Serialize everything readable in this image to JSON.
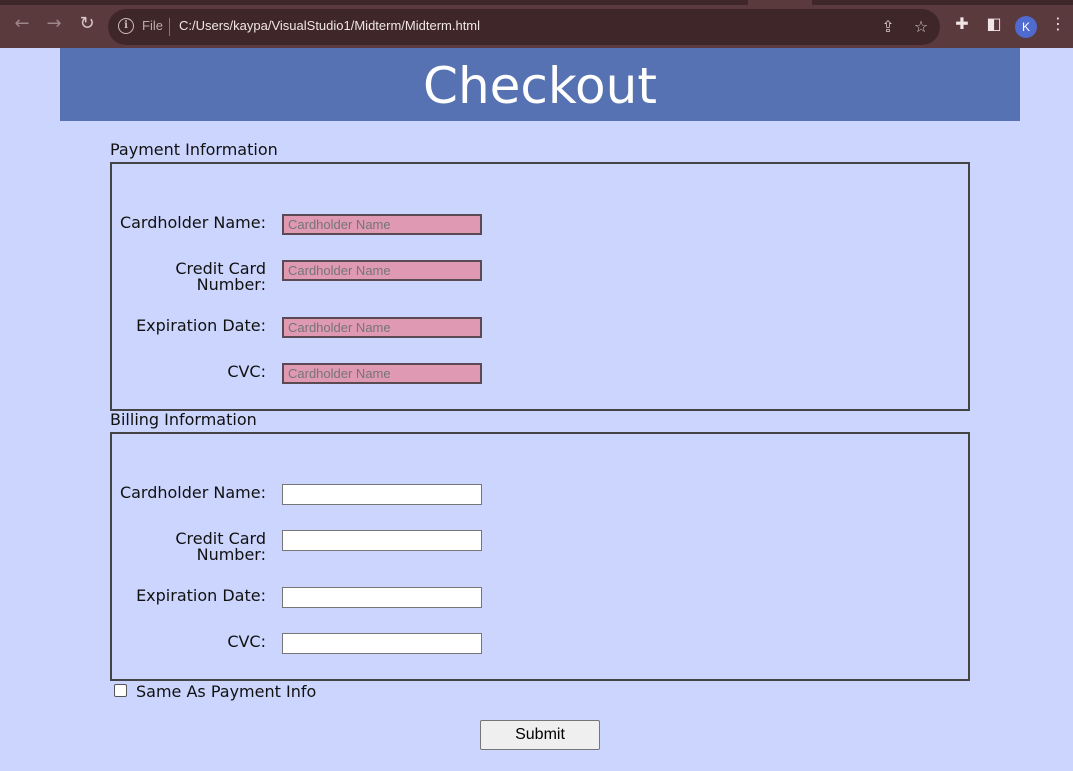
{
  "browser": {
    "file_label": "File",
    "url": "C:/Users/kaypa/VisualStudio1/Midterm/Midterm.html",
    "avatar_initial": "K",
    "icons": [
      "back-icon",
      "forward-icon",
      "reload-icon",
      "info-icon",
      "share-icon",
      "star-icon",
      "extensions-icon",
      "sidepanel-icon",
      "menu-icon"
    ]
  },
  "page": {
    "title": "Checkout",
    "payment": {
      "legend": "Payment Information",
      "fields": [
        {
          "label": "Cardholder Name:",
          "placeholder": "Cardholder Name"
        },
        {
          "label_line1": "Credit Card",
          "label_line2": "Number:",
          "placeholder": "Cardholder Name"
        },
        {
          "label": "Expiration Date:",
          "placeholder": "Cardholder Name"
        },
        {
          "label": "CVC:",
          "placeholder": "Cardholder Name"
        }
      ]
    },
    "billing": {
      "legend": "Billing Information",
      "fields": [
        {
          "label": "Cardholder Name:",
          "value": ""
        },
        {
          "label_line1": "Credit Card",
          "label_line2": "Number:",
          "value": ""
        },
        {
          "label": "Expiration Date:",
          "value": ""
        },
        {
          "label": "CVC:",
          "value": ""
        }
      ]
    },
    "same_as_payment": {
      "label": "Same As Payment Info",
      "checked": false
    },
    "submit_label": "Submit"
  },
  "colors": {
    "page_background": "#cbd5fd",
    "header_background": "#5672b2",
    "payment_input_background": "#df99b3"
  }
}
